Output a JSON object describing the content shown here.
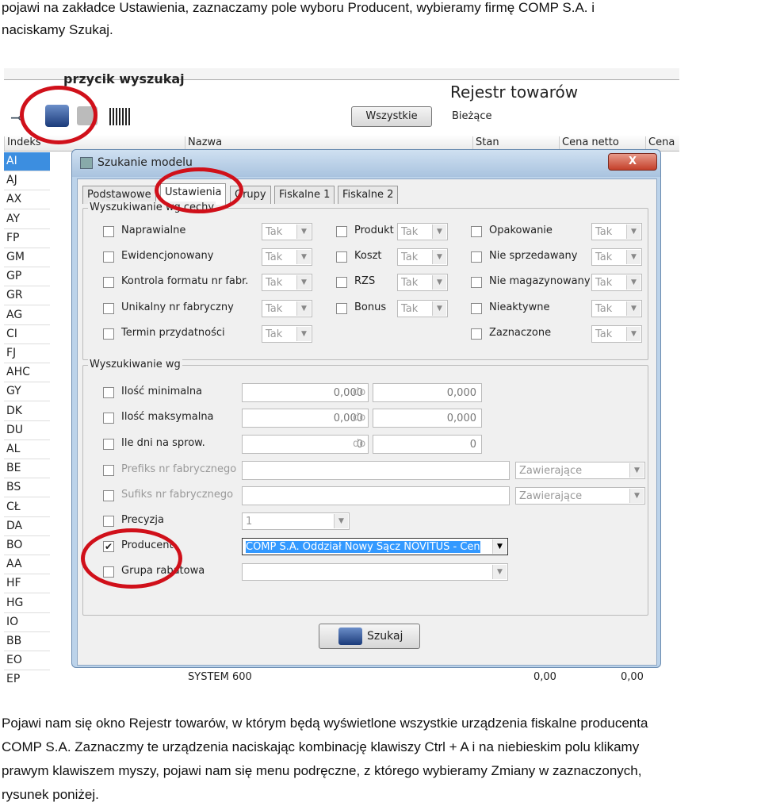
{
  "doc": {
    "line1": "pojawi na zakładce Ustawienia, zaznaczamy pole wyboru Producent, wybieramy firmę COMP S.A.  i",
    "line2": "naciskamy Szukaj.",
    "p2_1": "Pojawi nam się okno Rejestr towarów, w którym będą wyświetlone wszystkie urządzenia fiskalne producenta",
    "p2_2": "COMP S.A.  Zaznaczmy te  urządzenia naciskając kombinację klawiszy Ctrl + A i na niebieskim polu klikamy",
    "p2_3": "prawym klawiszem myszy, pojawi nam się menu podręczne, z którego wybieramy Zmiany w zaznaczonych,",
    "p2_4": "rysunek poniżej."
  },
  "annotation": "przycik wyszukaj",
  "register": {
    "title": "Rejestr towarów",
    "btn_all": "Wszystkie",
    "btn_current": "Bieżące",
    "columns": [
      "Indeks",
      "Nazwa",
      "Stan",
      "Cena netto",
      "Cena"
    ],
    "indexes": [
      "AI",
      "AJ",
      "AX",
      "AY",
      "FP",
      "GM",
      "GP",
      "GR",
      "AG",
      "CI",
      "FJ",
      "AHC",
      "GY",
      "DK",
      "DU",
      "AL",
      "BE",
      "BS",
      "CŁ",
      "DA",
      "BO",
      "AA",
      "HF",
      "HG",
      "IO",
      "BB",
      "EO",
      "EP"
    ],
    "last_row": {
      "name": "SYSTEM 600",
      "stan": "0,00",
      "cena": "0,00"
    }
  },
  "dialog": {
    "title": "Szukanie modelu",
    "close": "X",
    "tabs": [
      "Podstawowe",
      "Ustawienia",
      "Grupy",
      "Fiskalne 1",
      "Fiskalne 2"
    ],
    "active_tab": "Ustawienia",
    "group1": {
      "title": "Wyszukiwanie wg cechy",
      "combo_value": "Tak",
      "col1": [
        "Naprawialne",
        "Ewidencjonowany",
        "Kontrola formatu nr fabr.",
        "Unikalny nr fabryczny",
        "Termin przydatności"
      ],
      "col2": [
        "Produkt",
        "Koszt",
        "RZS",
        "Bonus"
      ],
      "col3": [
        "Opakowanie",
        "Nie sprzedawany",
        "Nie magazynowany",
        "Nieaktywne",
        "Zaznaczone"
      ]
    },
    "group2": {
      "title": "Wyszukiwanie wg",
      "do": "do",
      "qty_min": {
        "label": "Ilość minimalna",
        "from": "0,000",
        "to": "0,000"
      },
      "qty_max": {
        "label": "Ilość maksymalna",
        "from": "0,000",
        "to": "0,000"
      },
      "days": {
        "label": "Ile dni na sprow.",
        "from": "0",
        "to": "0"
      },
      "prefix": {
        "label": "Prefiks nr fabrycznego",
        "mode": "Zawierające"
      },
      "suffix": {
        "label": "Sufiks nr fabrycznego",
        "mode": "Zawierające"
      },
      "precision": {
        "label": "Precyzja",
        "value": "1"
      },
      "producer": {
        "label": "Producent",
        "checked": true,
        "value": "COMP S.A. Oddział Nowy Sącz NOVITUS - Cen"
      },
      "discount": {
        "label": "Grupa rabatowa",
        "value": ""
      }
    },
    "search_button": "Szukaj"
  },
  "colors": {
    "highlight": "#3399ff",
    "circle": "#d0101a",
    "selected_row": "#3c8ee0"
  }
}
